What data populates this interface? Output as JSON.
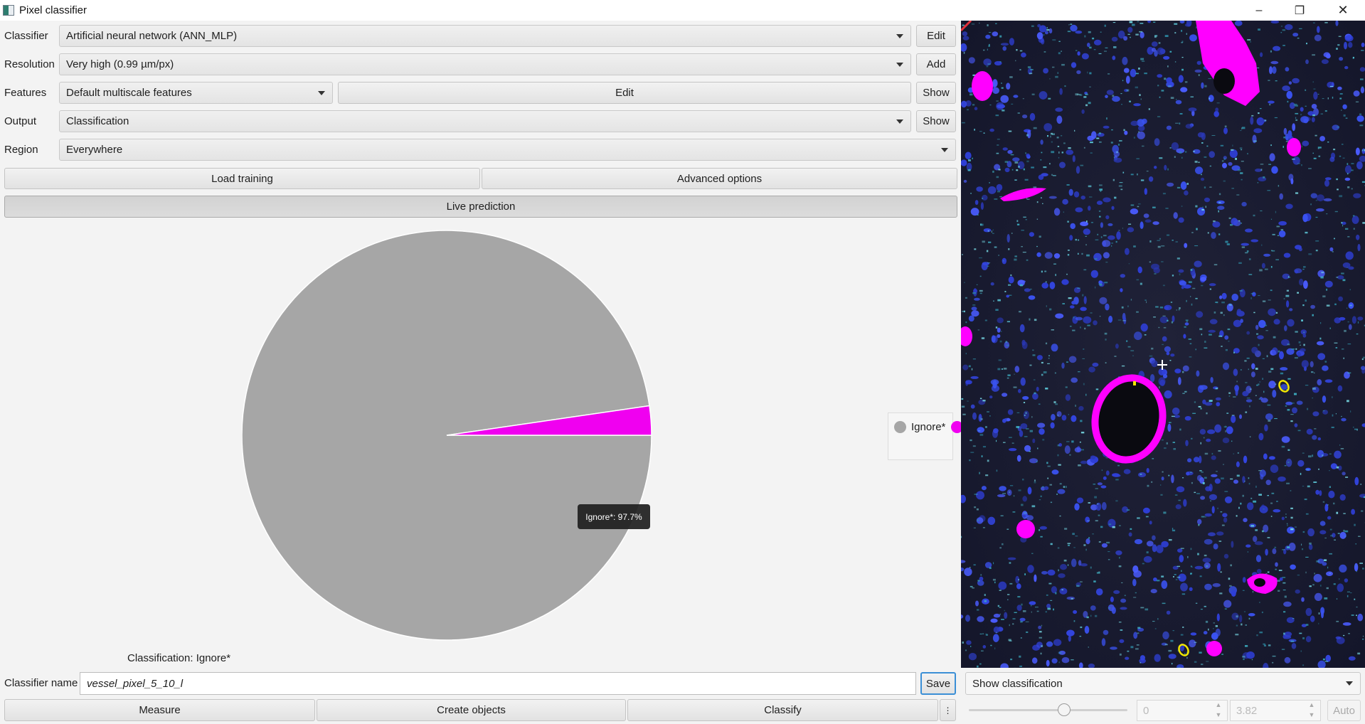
{
  "window": {
    "title": "Pixel classifier"
  },
  "rows": {
    "classifier": {
      "label": "Classifier",
      "value": "Artificial neural network (ANN_MLP)",
      "button": "Edit"
    },
    "resolution": {
      "label": "Resolution",
      "value": "Very high (0.99 µm/px)",
      "button": "Add"
    },
    "features": {
      "label": "Features",
      "value": "Default multiscale features",
      "edit_button": "Edit",
      "show_button": "Show"
    },
    "output": {
      "label": "Output",
      "value": "Classification",
      "button": "Show"
    },
    "region": {
      "label": "Region",
      "value": "Everywhere"
    }
  },
  "buttons": {
    "load_training": "Load training",
    "advanced_options": "Advanced options",
    "live_prediction": "Live prediction",
    "measure": "Measure",
    "create_objects": "Create objects",
    "classify": "Classify",
    "more": "⋮",
    "save": "Save"
  },
  "chart_data": {
    "type": "pie",
    "slices": [
      {
        "name": "Ignore*",
        "value": 97.7,
        "color": "#a6a6a6"
      },
      {
        "name": "",
        "value": 2.3,
        "color": "#f000f0"
      }
    ],
    "legend": [
      "Ignore*"
    ],
    "legend_placement": "right",
    "tooltip": "Ignore*: 97.7%"
  },
  "status": {
    "classification": "Classification: Ignore*"
  },
  "classifier_name": {
    "label": "Classifier name",
    "value": "vessel_pixel_5_10_l"
  },
  "viewer_controls": {
    "display_mode": "Show classification",
    "min_value": "0",
    "max_value": "3.82",
    "auto_button": "Auto",
    "opacity_slider": 0.6
  },
  "colors": {
    "accent": "#3b8fd6",
    "vessel": "#ff00ff",
    "ignore": "#a6a6a6"
  }
}
